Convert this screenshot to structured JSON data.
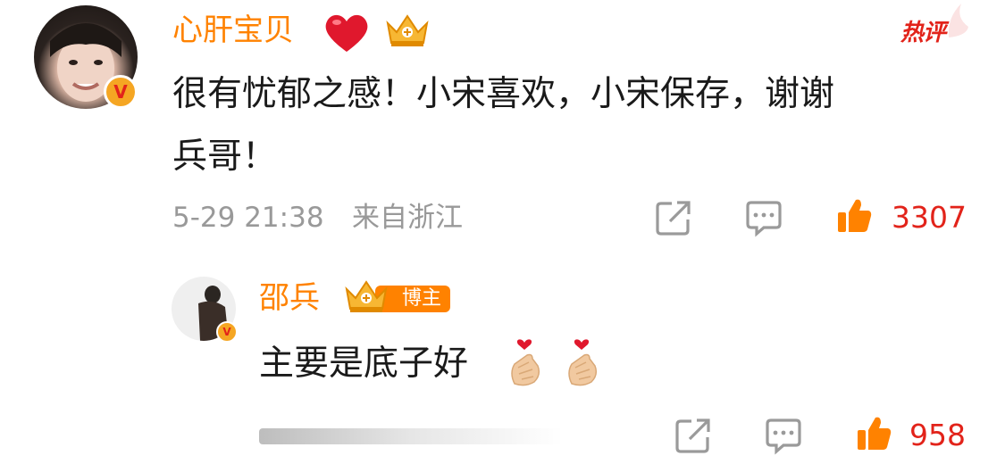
{
  "colors": {
    "name": "#ff8200",
    "text": "#1a1a1a",
    "meta": "#999999",
    "like": "#e2231a",
    "hot": "#e2231a"
  },
  "comment": {
    "author": "心肝宝贝",
    "author_emoji": "heart-emoji",
    "badge_icon": "crown-badge-icon",
    "hot_label": "热评",
    "body_line1": "很有忧郁之感！小宋喜欢，小宋保存，谢谢",
    "body_line2": "兵哥！",
    "time": "5-29 21:38",
    "location": "来自浙江",
    "likes": "3307",
    "verified_mark": "V"
  },
  "reply": {
    "author": "邵兵",
    "badge_icon": "crown-badge-icon",
    "role_tag": "博主",
    "body": "主要是底子好",
    "emojis": [
      "finger-heart-emoji",
      "finger-heart-emoji"
    ],
    "likes": "958",
    "verified_mark": "V"
  }
}
